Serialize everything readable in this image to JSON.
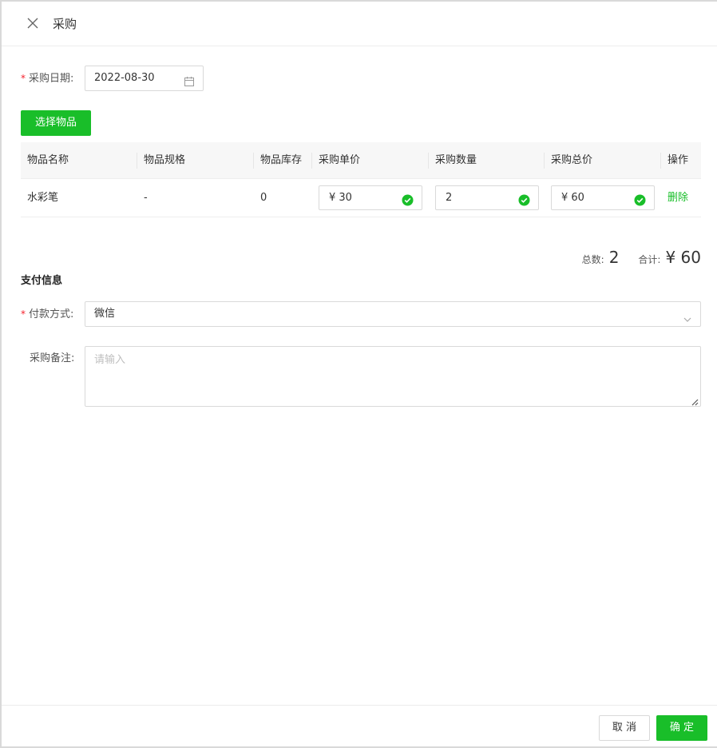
{
  "dialog": {
    "title": "采购"
  },
  "form": {
    "date_label": "采购日期:",
    "date_value": "2022-08-30",
    "select_items_button": "选择物品",
    "payment_section_title": "支付信息",
    "payment_label": "付款方式:",
    "payment_value": "微信",
    "remark_label": "采购备注:",
    "remark_placeholder": "请输入"
  },
  "table": {
    "headers": [
      "物品名称",
      "物品规格",
      "物品库存",
      "采购单价",
      "采购数量",
      "采购总价",
      "操作"
    ],
    "rows": [
      {
        "name": "水彩笔",
        "spec": "-",
        "stock": "0",
        "unit_price": "¥ 30",
        "quantity": "2",
        "total_price": "¥ 60",
        "action": "删除"
      }
    ]
  },
  "summary": {
    "count_label": "总数:",
    "count_value": "2",
    "total_label": "合计:",
    "total_value": "¥ 60"
  },
  "footer": {
    "cancel": "取 消",
    "confirm": "确 定"
  },
  "colors": {
    "accent": "#19be29",
    "required": "#f5222d"
  }
}
